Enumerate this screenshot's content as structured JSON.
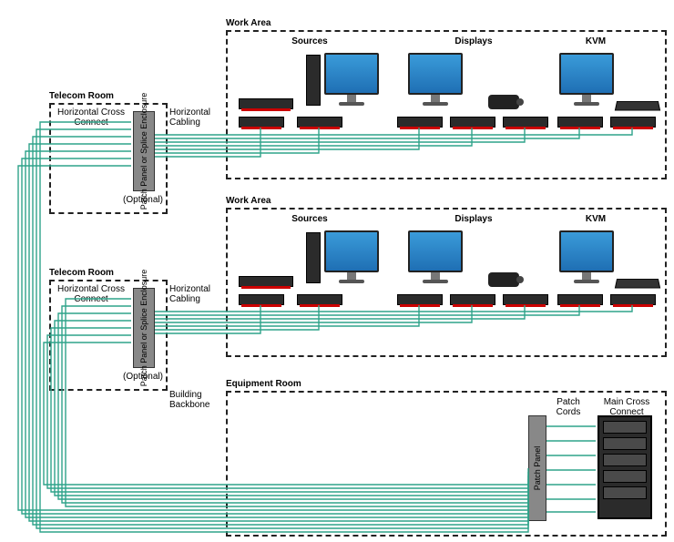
{
  "work_area_1": {
    "title": "Work Area",
    "columns": {
      "sources": "Sources",
      "displays": "Displays",
      "kvm": "KVM"
    }
  },
  "work_area_2": {
    "title": "Work Area",
    "columns": {
      "sources": "Sources",
      "displays": "Displays",
      "kvm": "KVM"
    }
  },
  "telecom_room_1": {
    "title": "Telecom Room",
    "cross_connect": "Horizontal Cross Connect",
    "patch_label": "Patch Panel or Splice Enclosure",
    "optional": "(Optional)",
    "horizontal_cabling": "Horizontal Cabling"
  },
  "telecom_room_2": {
    "title": "Telecom Room",
    "cross_connect": "Horizontal Cross Connect",
    "patch_label": "Patch Panel or Splice Enclosure",
    "optional": "(Optional)",
    "horizontal_cabling": "Horizontal Cabling",
    "building_backbone": "Building Backbone"
  },
  "equipment_room": {
    "title": "Equipment Room",
    "patch_cords": "Patch Cords",
    "patch_panel": "Patch Panel",
    "main_cross_connect": "Main Cross Connect"
  },
  "colors": {
    "cable": "#2fa38a",
    "dash": "#222222",
    "monitor": "#2a86c8"
  }
}
